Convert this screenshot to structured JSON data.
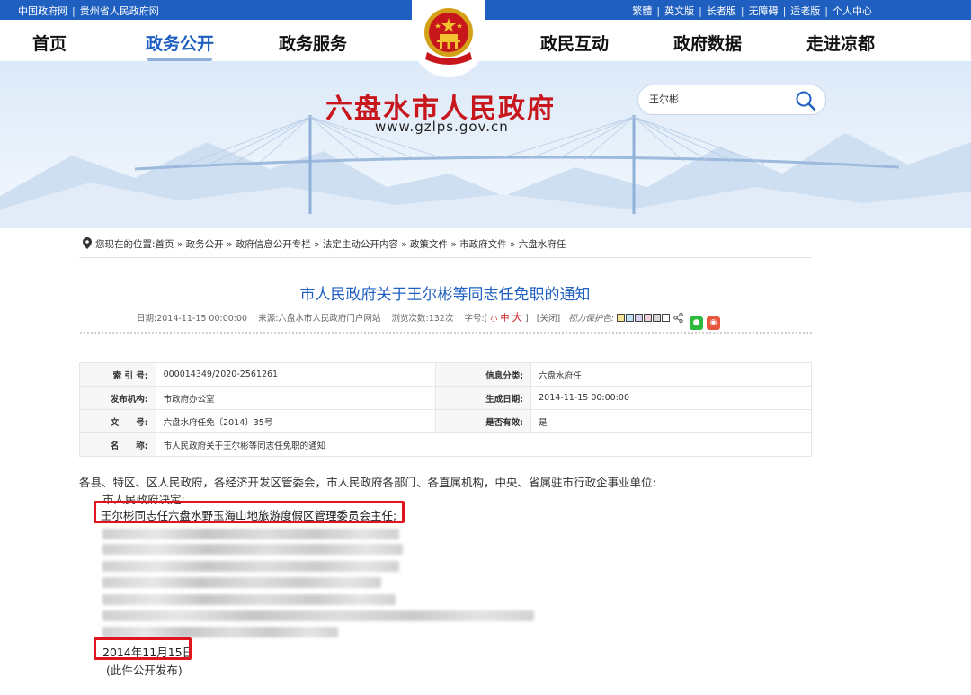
{
  "topbar": {
    "left_links": [
      "中国政府网",
      "贵州省人民政府网"
    ],
    "right_links": [
      "繁體",
      "英文版",
      "长者版",
      "无障碍",
      "适老版",
      "个人中心"
    ]
  },
  "nav": {
    "items": [
      "首页",
      "政务公开",
      "政务服务",
      "政民互动",
      "政府数据",
      "走进凉都"
    ],
    "active": "政务公开"
  },
  "banner": {
    "site_title": "六盘水市人民政府",
    "site_url": "www.gzlps.gov.cn"
  },
  "search": {
    "value": "王尔彬",
    "icon": "search-icon"
  },
  "breadcrumb": {
    "prefix": "您现在的位置:",
    "path": [
      "首页",
      "政务公开",
      "政府信息公开专栏",
      "法定主动公开内容",
      "政策文件",
      "市政府文件",
      "六盘水府任"
    ]
  },
  "article": {
    "title": "市人民政府关于王尔彬等同志任免职的通知",
    "meta": {
      "date_label": "日期:",
      "date": "2014-11-15 00:00:00",
      "source_label": "来源:",
      "source": "六盘水市人民政府门户网站",
      "views_label": "浏览次数:",
      "views": "132次",
      "font_label": "字号:",
      "font_open": "[",
      "font_small": "小",
      "font_mid": "中",
      "font_large": "大",
      "font_close": "]",
      "close": "[关闭]",
      "eye_label": "视力保护色:"
    },
    "eye_colors": [
      "#f8e79b",
      "#bfe3f5",
      "#d8d3f0",
      "#f0d0e0",
      "#d7d7d7",
      "#ffffff"
    ]
  },
  "info": {
    "rows": [
      {
        "k1": "索 引 号:",
        "v1": "000014349/2020-2561261",
        "k2": "信息分类:",
        "v2": "六盘水府任"
      },
      {
        "k1": "发布机构:",
        "v1": "市政府办公室",
        "k2": "生成日期:",
        "v2": "2014-11-15 00:00:00"
      },
      {
        "k1": "文　　号:",
        "v1": "六盘水府任免〔2014〕35号",
        "k2": "是否有效:",
        "v2": "是"
      },
      {
        "k1": "名　　称:",
        "v1": "市人民政府关于王尔彬等同志任免职的通知",
        "k2": "",
        "v2": ""
      }
    ]
  },
  "body": {
    "salutation": "各县、特区、区人民政府，各经济开发区管委会，市人民政府各部门、各直属机构，中央、省属驻市行政企事业单位:",
    "decision": "市人民政府决定:",
    "highlight": "王尔彬同志任六盘水野玉海山地旅游度假区管理委员会主任;",
    "date": "2014年11月15日",
    "note": "(此件公开发布)"
  }
}
